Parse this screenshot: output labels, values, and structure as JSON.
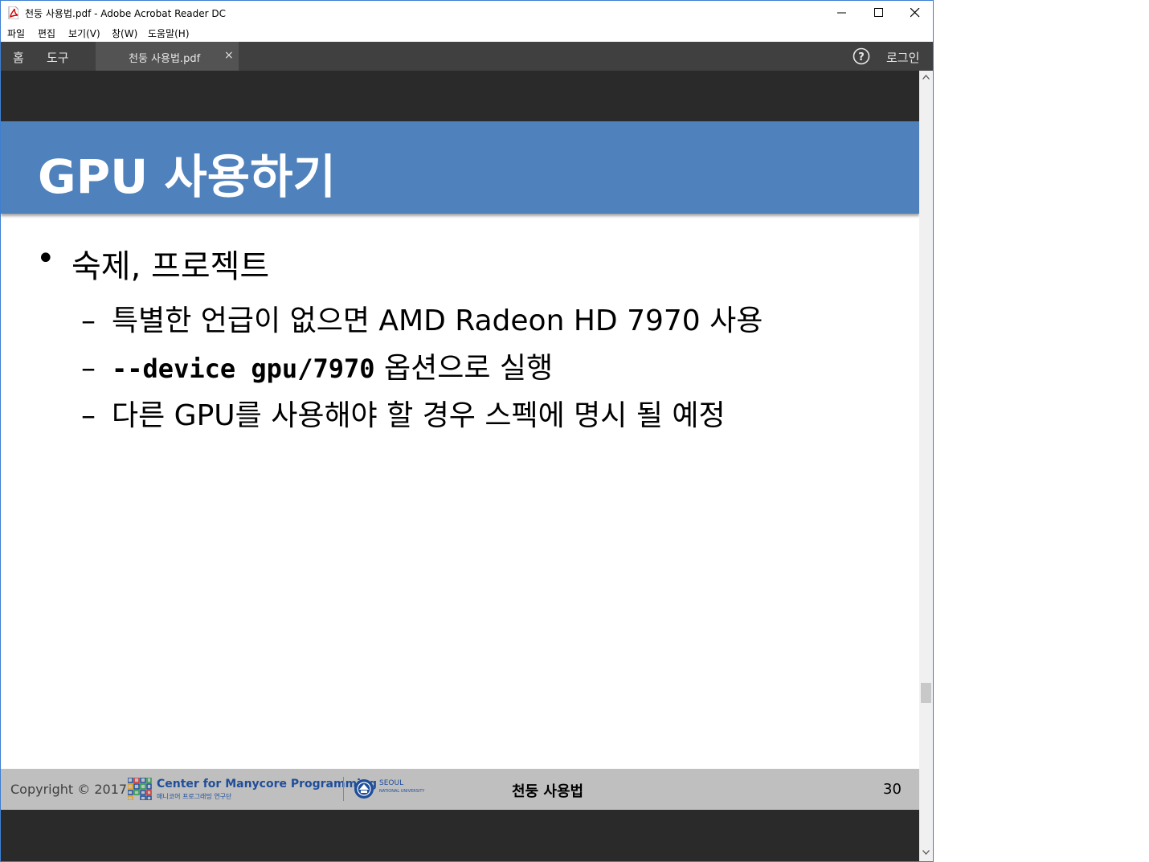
{
  "window": {
    "title": "천둥 사용법.pdf - Adobe Acrobat Reader DC"
  },
  "menu": [
    "파일",
    "편집",
    "보기(V)",
    "창(W)",
    "도움말(H)"
  ],
  "tabs": {
    "home": "홈",
    "tools": "도구",
    "document": "천둥 사용법.pdf",
    "close": "×",
    "login": "로그인"
  },
  "slide": {
    "title": "GPU 사용하기",
    "bullet_marker": "•",
    "bullet": "숙제, 프로젝트",
    "sub_marker": "–",
    "sub1": "특별한 언급이 없으면 AMD Radeon HD 7970 사용",
    "sub2_code": "--device gpu/7970",
    "sub2_text": " 옵션으로 실행",
    "sub3": "다른 GPU를 사용해야 할 경우 스펙에 명시 될 예정"
  },
  "footer": {
    "copyright": "Copyright © 2017",
    "center_name": "Center for Manycore Programming",
    "center_sub": "매니코어 프로그래밍 연구단",
    "university_name": "SEOUL",
    "university_sub": "NATIONAL UNIVERSITY",
    "title": "천둥 사용법",
    "page_number": "30"
  },
  "colors": {
    "header_blue": "#4f81bd",
    "toolbar_dark": "#404040",
    "doc_background": "#2a2a2a",
    "footer_gray": "#bfbfbf"
  }
}
